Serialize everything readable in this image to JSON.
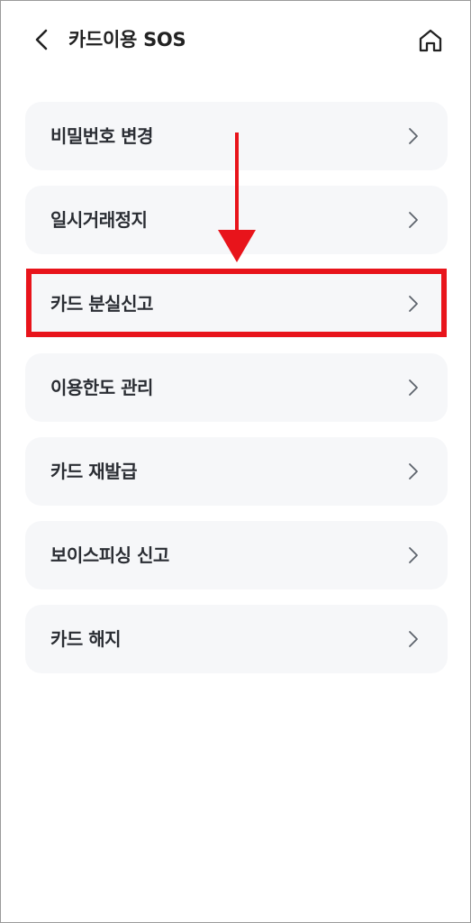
{
  "header": {
    "title": "카드이용 SOS",
    "back_icon": "chevron-left-icon",
    "home_icon": "home-icon"
  },
  "menu": {
    "items": [
      {
        "label": "비밀번호 변경"
      },
      {
        "label": "일시거래정지"
      },
      {
        "label": "카드 분실신고"
      },
      {
        "label": "이용한도 관리"
      },
      {
        "label": "카드 재발급"
      },
      {
        "label": "보이스피싱 신고"
      },
      {
        "label": "카드 해지"
      }
    ],
    "highlighted_item": "카드 분실신고"
  },
  "colors": {
    "highlight": "#e8141b",
    "item_background": "#f6f7f9",
    "text": "#2a2d33"
  }
}
